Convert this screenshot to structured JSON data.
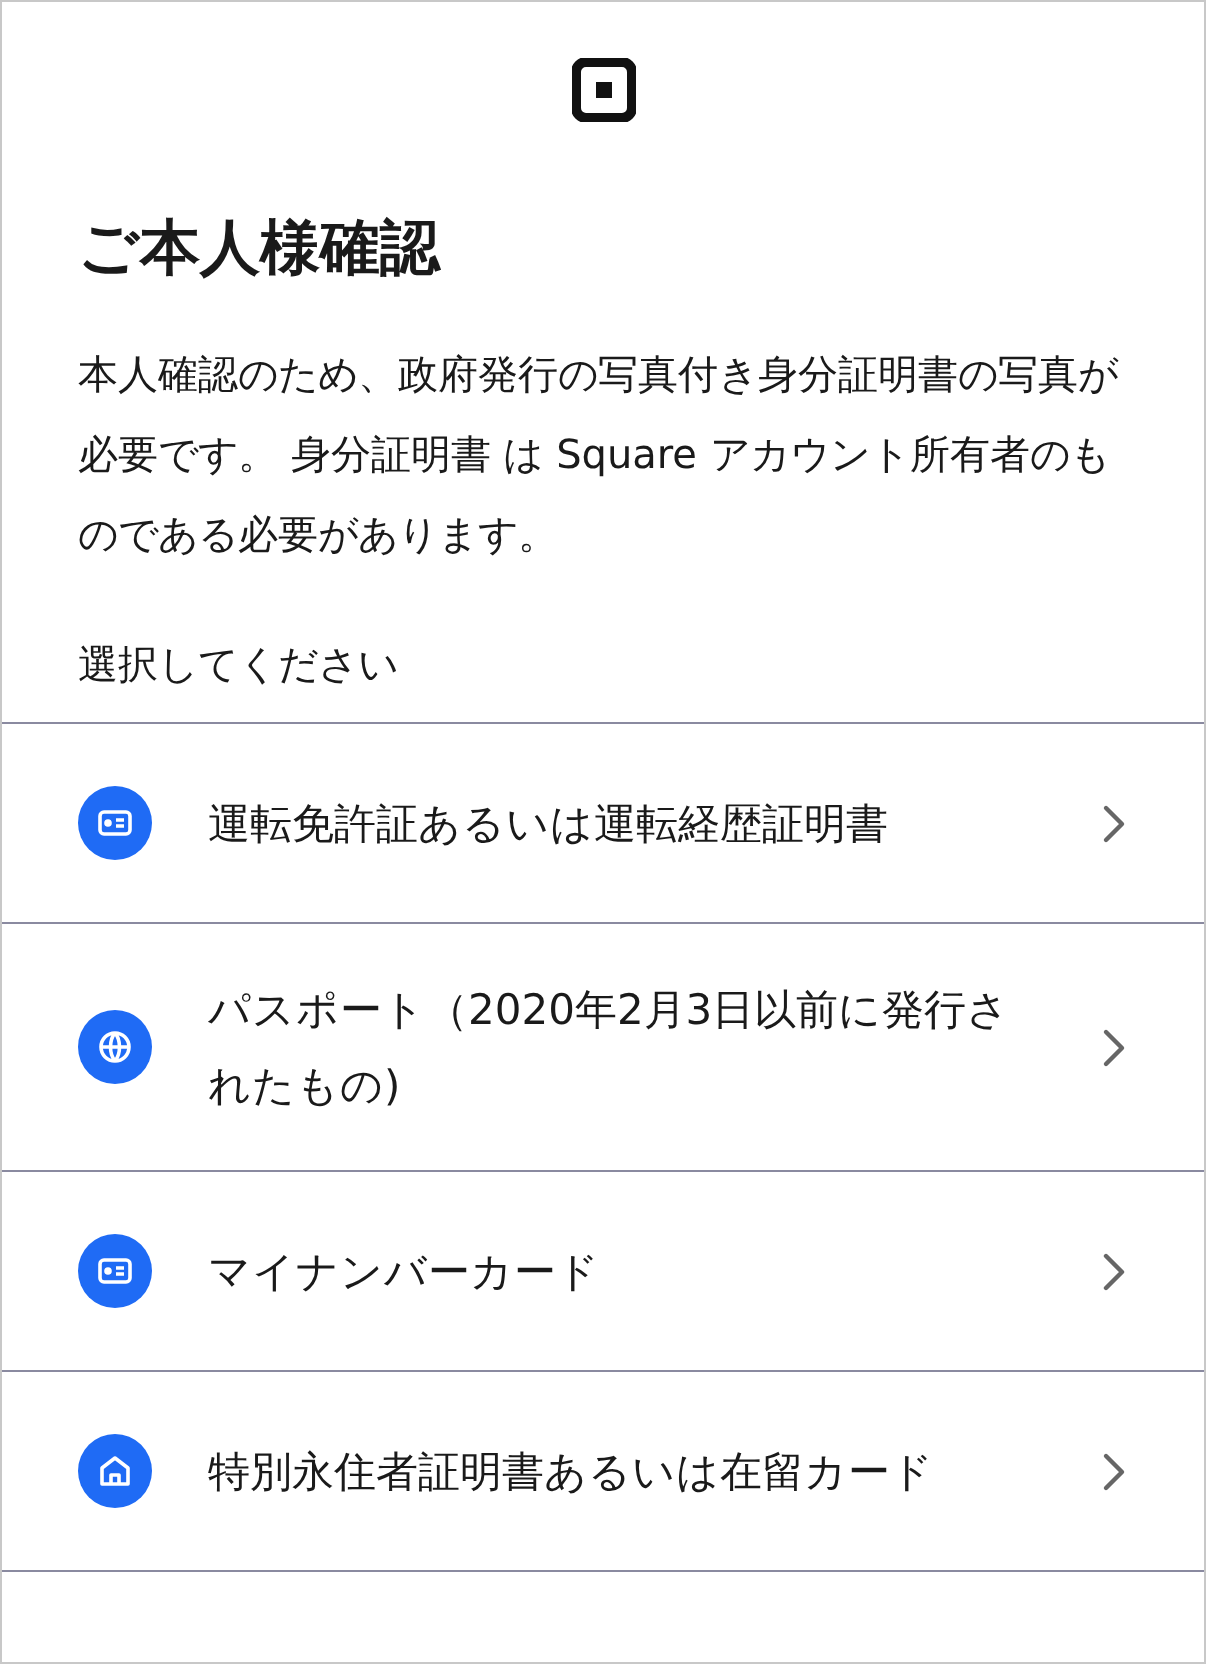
{
  "title": "ご本人様確認",
  "description": "本人確認のため、政府発行の写真付き身分証明書の写真が必要です。 身分証明書 は Square アカウント所有者のものである必要があります。",
  "prompt": "選択してください",
  "options": [
    {
      "kind": "card",
      "label": "運転免許証あるいは運転経歴証明書"
    },
    {
      "kind": "globe",
      "label": "パスポート（2020年2月3日以前に発行されたもの)"
    },
    {
      "kind": "card",
      "label": "マイナンバーカード"
    },
    {
      "kind": "home",
      "label": "特別永住者証明書あるいは在留カード"
    }
  ]
}
